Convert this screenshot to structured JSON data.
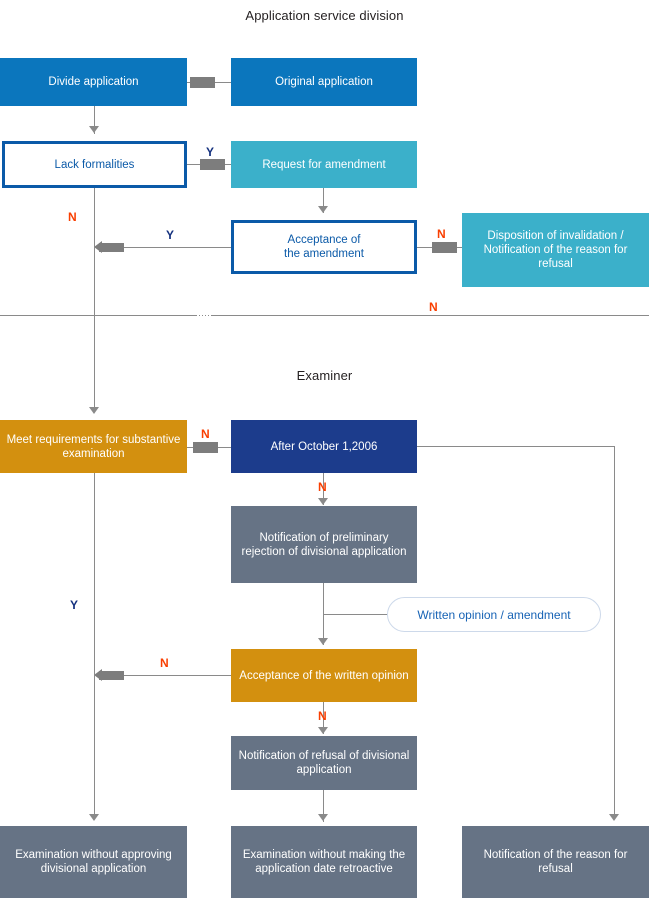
{
  "diagram": {
    "title_top": "Application service division",
    "title_bottom": "Examiner"
  },
  "nodes": {
    "divide_application": "Divide application",
    "original_application": "Original application",
    "lack_formalities": "Lack formalities",
    "request_for_amendment": "Request for amendment",
    "acceptance_of_amendment_l1": "Acceptance of",
    "acceptance_of_amendment_l2": "the amendment",
    "disposition_invalidation": "Disposition of invalidation / Notification of the reason for refusal",
    "meet_requirements": "Meet requirements for substantive examination",
    "after_october": "After October 1,2006",
    "notification_preliminary_rejection": "Notification of preliminary rejection of divisional application",
    "written_opinion_amendment": "Written opinion / amendment",
    "acceptance_written_opinion": "Acceptance of the written opinion",
    "notification_refusal_divisional": "Notification of refusal of divisional application",
    "examination_without_approving": "Examination without approving divisional application",
    "examination_without_retroactive": "Examination without making the application date retroactive",
    "notification_reason_refusal": "Notification of the reason for refusal"
  },
  "labels": {
    "y_lack_formalities": "Y",
    "n_lack_formalities": "N",
    "y_acceptance_amendment": "Y",
    "n_acceptance_amendment": "N",
    "n_disposition_return": "N",
    "n_meet_requirements": "N",
    "n_after_october": "N",
    "y_meet_requirements": "Y",
    "n_acceptance_written": "N",
    "n_written_opinion_refusal": "N"
  },
  "colors": {
    "blue": "#0b76bd",
    "navy": "#1c3c8c",
    "cyan": "#3bb0ca",
    "orange": "#d3900f",
    "gray": "#667385",
    "outline_border": "#0b5aa8",
    "label_n": "#f93f02",
    "label_y": "#13307e",
    "connector": "#8a8a8a"
  }
}
